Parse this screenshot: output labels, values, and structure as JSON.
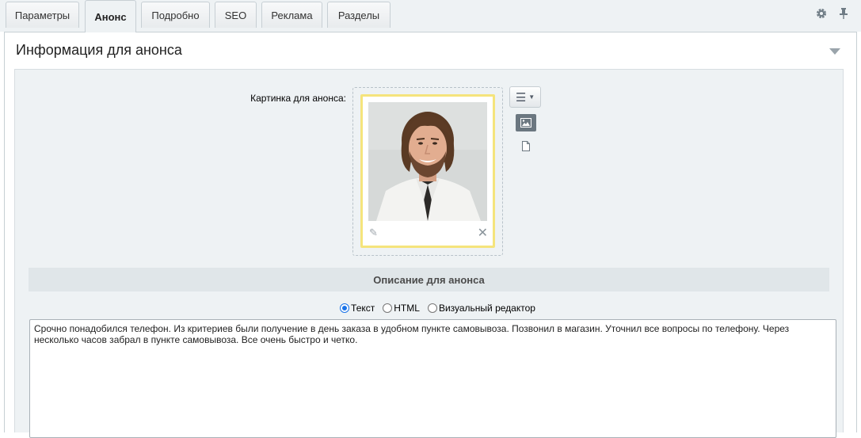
{
  "tabs": [
    {
      "label": "Параметры"
    },
    {
      "label": "Анонс"
    },
    {
      "label": "Подробно"
    },
    {
      "label": "SEO"
    },
    {
      "label": "Реклама"
    },
    {
      "label": "Разделы"
    }
  ],
  "active_tab": "Анонс",
  "toolbar": {
    "settings_icon": "gear-icon",
    "pin_icon": "pin-icon"
  },
  "section": {
    "title": "Информация для анонса"
  },
  "picture": {
    "label": "Картинка для анонса:",
    "edit_icon": "pencil-icon",
    "delete_icon": "close-icon",
    "menu_icon": "hamburger-icon"
  },
  "description": {
    "header": "Описание для анонса",
    "modes": [
      "Текст",
      "HTML",
      "Визуальный редактор"
    ],
    "selected_mode": "Текст",
    "text": "Срочно понадобился телефон. Из критериев были получение в день заказа в удобном пункте самовывоза. Позвонил в магазин. Уточнил все вопросы по телефону. Через несколько часов забрал в пункте самовывоза. Все очень быстро и четко."
  },
  "colors": {
    "panel_bg": "#eef2f4",
    "card_border": "#f5e47c",
    "radio_accent": "#1a73e8"
  }
}
